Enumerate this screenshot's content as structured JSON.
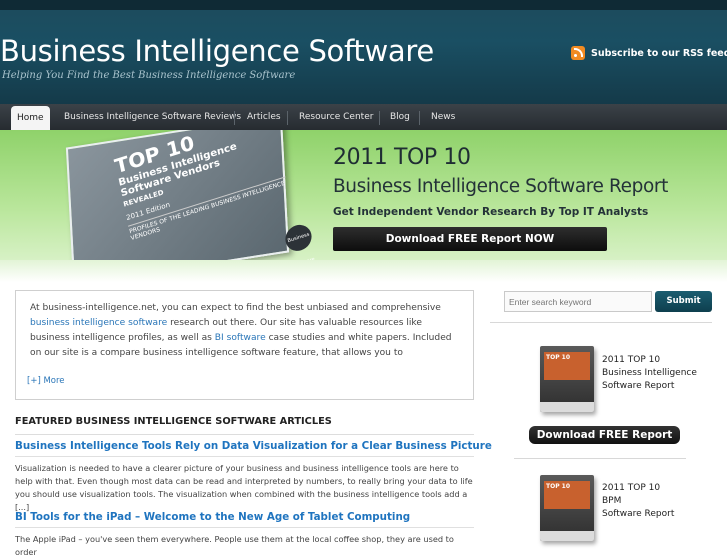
{
  "header": {
    "title": "Business Intelligence Software",
    "tagline": "Helping You Find the Best Business Intelligence Software",
    "rss_label": "Subscribe to our RSS feed",
    "rss_icon": "rss-icon"
  },
  "nav": {
    "items": [
      {
        "label": "Home"
      },
      {
        "label": "Business Intelligence Software Reviews"
      },
      {
        "label": "Articles"
      },
      {
        "label": "Resource Center"
      },
      {
        "label": "Blog"
      },
      {
        "label": "News"
      }
    ]
  },
  "banner": {
    "book": {
      "top": "TOP 10",
      "subtitle": "Business Intelligence Software Vendors",
      "revealed": "REVEALED",
      "edition": "2011 Edition",
      "profiles": "PROFILES OF THE LEADING BUSINESS INTELLIGENCE VENDORS",
      "logo": "Business Software"
    },
    "title_line1": "2011 TOP 10",
    "title_line2": "Business Intelligence Software Report",
    "subtitle": "Get Independent Vendor Research By Top IT Analysts",
    "button_label": "Download FREE Report NOW"
  },
  "intro": {
    "part1": "At business-intelligence.net, you can expect to find the best unbiased and comprehensive ",
    "link1": "business intelligence software",
    "part2": " research out there. Our site has valuable resources like business intelligence profiles, as well as ",
    "link2": "BI software",
    "part3": " case studies and white papers. Included on our site is a compare business intelligence software feature, that allows you to",
    "more_label": "[+] More"
  },
  "featured": {
    "heading": "FEATURED BUSINESS INTELLIGENCE SOFTWARE ARTICLES",
    "articles": [
      {
        "title": "Business Intelligence Tools Rely on Data Visualization for a Clear Business Picture",
        "excerpt": "Visualization is needed to have a clearer picture of your business and business intelligence tools are here to help with that. Even though most data can be read and interpreted by numbers, to really bring your data to life you should use visualization tools. The visualization when combined with the business intelligence tools add a [...]"
      },
      {
        "title": "BI Tools for the iPad – Welcome to the New Age of Tablet Computing",
        "excerpt": "The Apple iPad – you've seen them everywhere. People use them at the local coffee shop, they are used to order"
      }
    ]
  },
  "sidebar": {
    "search_placeholder": "Enter search keyword",
    "search_button": "Submit",
    "promo1": {
      "book_label": "TOP 10",
      "line1": "2011 TOP 10",
      "line2": "Business Intelligence",
      "line3": "Software Report"
    },
    "download_button": "Download FREE Report",
    "promo2": {
      "book_label": "TOP 10",
      "line1": "2011 TOP 10",
      "line2": "BPM",
      "line3": "Software Report"
    }
  },
  "colors": {
    "header_bg": "#1a4f63",
    "nav_bg": "#2f353a",
    "banner_green": "#a8df85",
    "link_blue": "#1f74bf",
    "rss_orange": "#f28b22"
  }
}
